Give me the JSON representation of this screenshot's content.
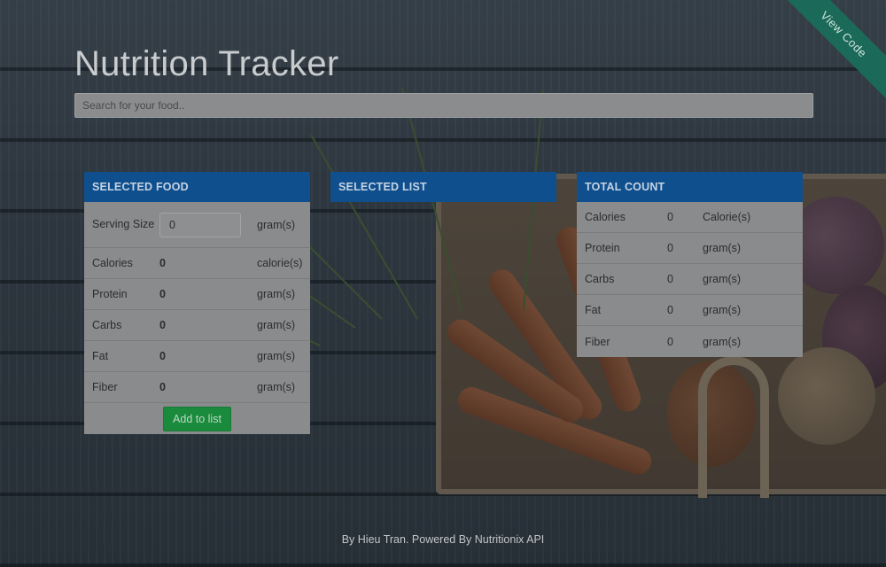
{
  "app": {
    "title": "Nutrition Tracker",
    "ribbon_label": "View Code"
  },
  "search": {
    "placeholder": "Search for your food..",
    "value": ""
  },
  "selected_food": {
    "header": "SELECTED FOOD",
    "serving": {
      "label": "Serving Size",
      "value": "0",
      "unit": "gram(s)"
    },
    "rows": [
      {
        "label": "Calories",
        "value": "0",
        "unit": "calorie(s)"
      },
      {
        "label": "Protein",
        "value": "0",
        "unit": "gram(s)"
      },
      {
        "label": "Carbs",
        "value": "0",
        "unit": "gram(s)"
      },
      {
        "label": "Fat",
        "value": "0",
        "unit": "gram(s)"
      },
      {
        "label": "Fiber",
        "value": "0",
        "unit": "gram(s)"
      }
    ],
    "add_button": "Add to list"
  },
  "selected_list": {
    "header": "SELECTED LIST"
  },
  "total_count": {
    "header": "TOTAL COUNT",
    "rows": [
      {
        "label": "Calories",
        "value": "0",
        "unit": "Calorie(s)"
      },
      {
        "label": "Protein",
        "value": "0",
        "unit": "gram(s)"
      },
      {
        "label": "Carbs",
        "value": "0",
        "unit": "gram(s)"
      },
      {
        "label": "Fat",
        "value": "0",
        "unit": "gram(s)"
      },
      {
        "label": "Fiber",
        "value": "0",
        "unit": "gram(s)"
      }
    ]
  },
  "footer": {
    "text": "By Hieu Tran. Powered By Nutritionix API"
  },
  "colors": {
    "header_blue": "#0f4f8e",
    "add_button_green": "#1a8a3c",
    "ribbon_green": "#1b6a59"
  }
}
